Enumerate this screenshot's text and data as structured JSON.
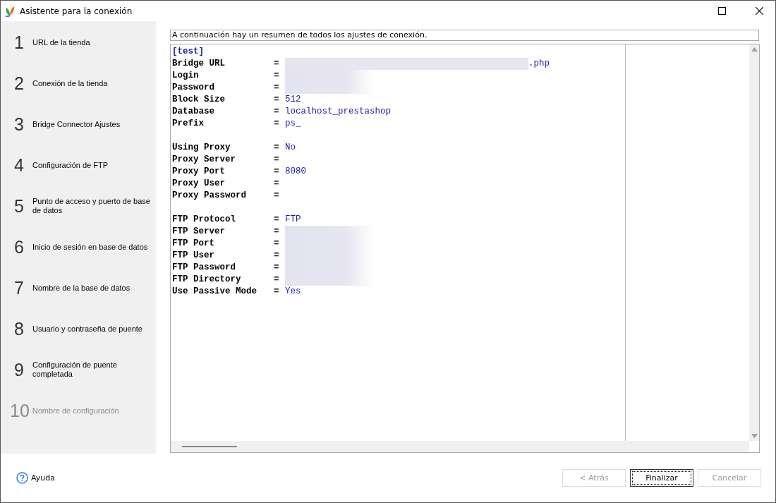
{
  "window": {
    "title": "Asistente para la conexión"
  },
  "steps": [
    {
      "number": "1",
      "label": "URL de la tienda",
      "disabled": false
    },
    {
      "number": "2",
      "label": "Conexión de la tienda",
      "disabled": false
    },
    {
      "number": "3",
      "label": "Bridge Connector Ajustes",
      "disabled": false
    },
    {
      "number": "4",
      "label": "Configuración de FTP",
      "disabled": false
    },
    {
      "number": "5",
      "label": "Punto de acceso y puerto de base de datos",
      "disabled": false
    },
    {
      "number": "6",
      "label": "Inicio de sesión en base de datos",
      "disabled": false
    },
    {
      "number": "7",
      "label": "Nombre de la base de datos",
      "disabled": false
    },
    {
      "number": "8",
      "label": "Usuario y contraseña de puente",
      "disabled": false
    },
    {
      "number": "9",
      "label": "Configuración de puente completada",
      "disabled": false
    },
    {
      "number": "10",
      "label": "Nombre de configuración",
      "disabled": true
    }
  ],
  "summary_caption": "A continuación hay un resumen de todos los ajustes de conexión.",
  "summary": {
    "section": "[test]",
    "lines": [
      {
        "kind": "setting",
        "key": "Bridge URL",
        "value": ".php",
        "redacted": true
      },
      {
        "kind": "setting",
        "key": "Login",
        "redacted": true
      },
      {
        "kind": "setting",
        "key": "Password",
        "redacted": true
      },
      {
        "kind": "setting",
        "key": "Block Size",
        "value": "512",
        "redacted": false
      },
      {
        "kind": "setting",
        "key": "Database",
        "value": "localhost_prestashop",
        "redacted": false
      },
      {
        "kind": "setting",
        "key": "Prefix",
        "value": "ps_",
        "redacted": false
      },
      {
        "kind": "blank"
      },
      {
        "kind": "setting",
        "key": "Using Proxy",
        "value": "No",
        "redacted": false
      },
      {
        "kind": "setting",
        "key": "Proxy Server",
        "redacted": false
      },
      {
        "kind": "setting",
        "key": "Proxy Port",
        "value": "8080",
        "redacted": false
      },
      {
        "kind": "setting",
        "key": "Proxy User",
        "redacted": false
      },
      {
        "kind": "setting",
        "key": "Proxy Password",
        "redacted": false
      },
      {
        "kind": "blank"
      },
      {
        "kind": "setting",
        "key": "FTP Protocol",
        "value": "FTP",
        "redacted": false
      },
      {
        "kind": "setting",
        "key": "FTP Server",
        "redacted": true
      },
      {
        "kind": "setting",
        "key": "FTP Port",
        "redacted": true
      },
      {
        "kind": "setting",
        "key": "FTP User",
        "redacted": true
      },
      {
        "kind": "setting",
        "key": "FTP Password",
        "redacted": true
      },
      {
        "kind": "setting",
        "key": "FTP Directory",
        "redacted": true
      },
      {
        "kind": "setting",
        "key": "Use Passive Mode",
        "value": "Yes",
        "redacted": false
      }
    ],
    "separator": "="
  },
  "help_link": "Ayuda",
  "buttons": [
    {
      "label": "< Atrás",
      "disabled": true,
      "default": false
    },
    {
      "label": "Finalizar",
      "disabled": false,
      "default": true
    },
    {
      "label": "Cancelar",
      "disabled": true,
      "default": false
    }
  ]
}
